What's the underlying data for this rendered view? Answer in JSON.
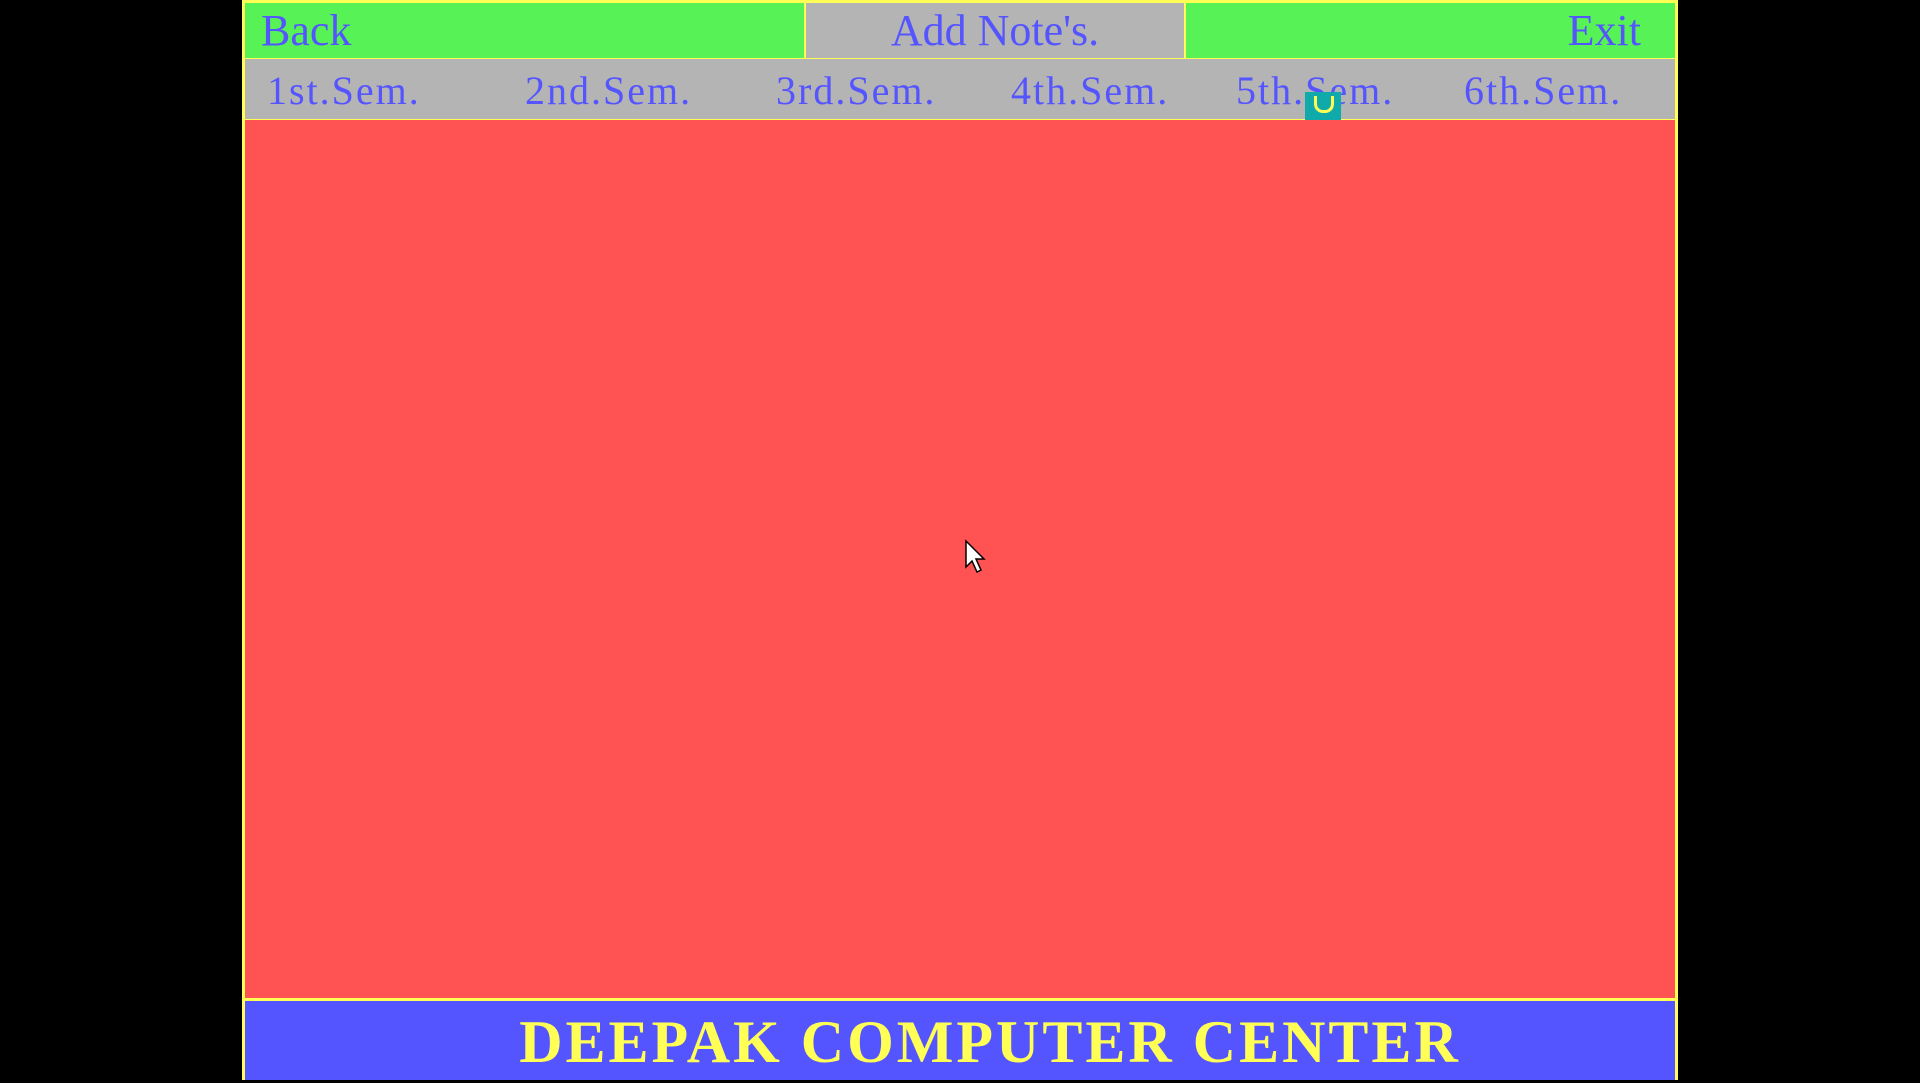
{
  "top_bar": {
    "back_label": "Back",
    "add_notes_label": "Add  Note's.",
    "exit_label": "Exit"
  },
  "semesters": [
    {
      "label": "1st.Sem."
    },
    {
      "label": "2nd.Sem."
    },
    {
      "label": "3rd.Sem."
    },
    {
      "label": "4th.Sem."
    },
    {
      "label": "5th.Sem."
    },
    {
      "label": "6th.Sem."
    }
  ],
  "footer": {
    "title": "DEEPAK COMPUTER CENTER"
  },
  "icons": {
    "text_cursor": "text-cursor-block-icon",
    "mouse_pointer": "mouse-pointer-icon"
  },
  "colors": {
    "top_bar": "#56f256",
    "menu_bar": "#b4b4b4",
    "content": "#ff5252",
    "footer": "#5555ff",
    "border": "#ffff55",
    "menu_text": "#5555ff",
    "footer_text": "#ffff55"
  }
}
